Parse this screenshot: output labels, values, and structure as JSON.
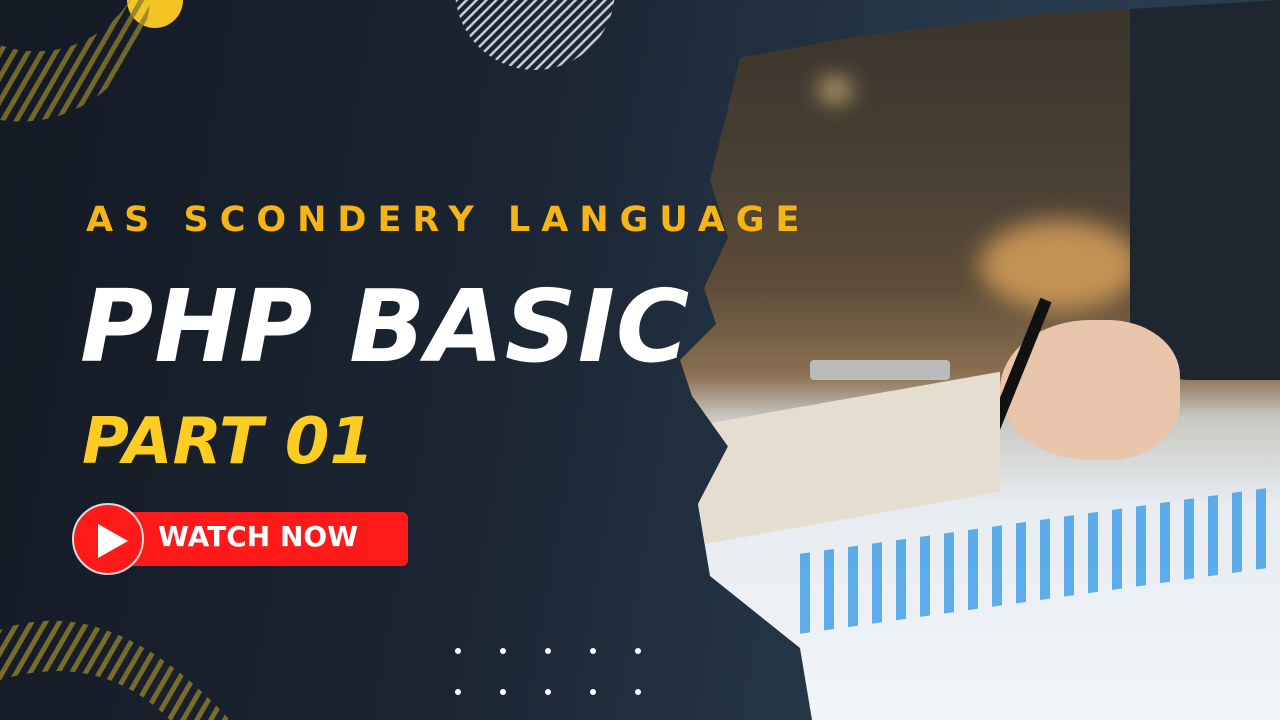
{
  "subtitle": "AS SCONDERY LANGUAGE",
  "title": "PHP BASIC",
  "part": "PART 01",
  "cta": {
    "label": "WATCH NOW",
    "icon": "play-icon"
  },
  "colors": {
    "accent_yellow": "#f7b515",
    "cta_red": "#ff1a1a",
    "background": "#1b2533"
  }
}
